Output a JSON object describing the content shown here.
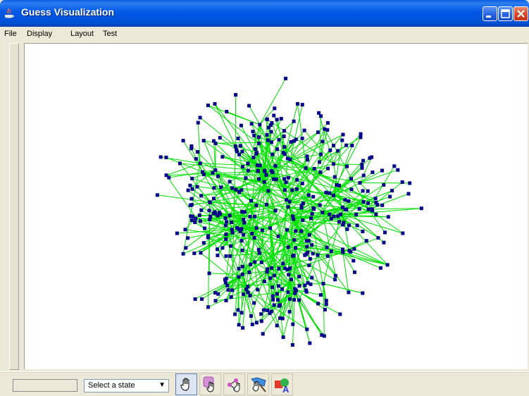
{
  "window": {
    "title": "Guess Visualization"
  },
  "menu": [
    "File",
    "Display",
    "Layout",
    "Test"
  ],
  "bottom": {
    "state_select_value": "Select a state",
    "status_text": ""
  },
  "tools": [
    {
      "name": "pan-hand-tool",
      "icon": "hand-icon",
      "active": true
    },
    {
      "name": "select-tool",
      "icon": "pointer-select-icon",
      "active": false
    },
    {
      "name": "node-edit-tool",
      "icon": "node-drag-icon",
      "active": false
    },
    {
      "name": "zoom-region-tool",
      "icon": "brush-icon",
      "active": false
    },
    {
      "name": "label-tool",
      "icon": "shapes-label-icon",
      "active": false
    }
  ],
  "colors": {
    "node": "#00008b",
    "edge": "#00e000",
    "title_bar": "#0058e6"
  }
}
